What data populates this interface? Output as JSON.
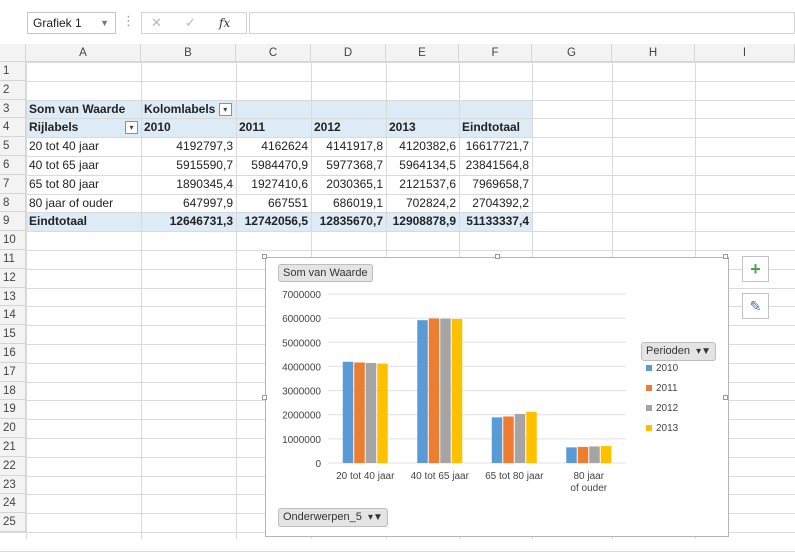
{
  "formula_bar": {
    "name_box": "Grafiek 1",
    "fx_label": "fx",
    "formula": ""
  },
  "columns": [
    "A",
    "B",
    "C",
    "D",
    "E",
    "F",
    "G",
    "H",
    "I"
  ],
  "rows": [
    "1",
    "2",
    "3",
    "4",
    "5",
    "6",
    "7",
    "8",
    "9",
    "10",
    "11",
    "12",
    "13",
    "14",
    "15",
    "16",
    "17",
    "18",
    "19",
    "20",
    "21",
    "22",
    "23",
    "24",
    "25"
  ],
  "pivot": {
    "values_header": "Som van Waarde",
    "column_labels": "Kolomlabels",
    "row_labels": "Rijlabels",
    "years": [
      "2010",
      "2011",
      "2012",
      "2013"
    ],
    "grand_total_label": "Eindtotaal",
    "data_rows": [
      {
        "label": "20 tot 40 jaar",
        "values": [
          "4192797,3",
          "4162624",
          "4141917,8",
          "4120382,6",
          "16617721,7"
        ]
      },
      {
        "label": "40 tot 65 jaar",
        "values": [
          "5915590,7",
          "5984470,9",
          "5977368,7",
          "5964134,5",
          "23841564,8"
        ]
      },
      {
        "label": "65 tot 80 jaar",
        "values": [
          "1890345,4",
          "1927410,6",
          "2030365,1",
          "2121537,6",
          "7969658,7"
        ]
      },
      {
        "label": "80 jaar of ouder",
        "values": [
          "647997,9",
          "667551",
          "686019,1",
          "702824,2",
          "2704392,2"
        ]
      }
    ],
    "total_row": {
      "label": "Eindtotaal",
      "values": [
        "12646731,3",
        "12742056,5",
        "12835670,7",
        "12908878,9",
        "51133337,4"
      ]
    }
  },
  "chart_field_buttons": {
    "values": "Som van Waarde",
    "legend": "Perioden",
    "axis": "Onderwerpen_5"
  },
  "chart_data": {
    "type": "bar",
    "categories": [
      "20 tot 40 jaar",
      "40 tot 65 jaar",
      "65 tot 80 jaar",
      "80 jaar of ouder"
    ],
    "series": [
      {
        "name": "2010",
        "color": "#5b9bd5",
        "values": [
          4192797.3,
          5915590.7,
          1890345.4,
          647997.9
        ]
      },
      {
        "name": "2011",
        "color": "#ed7d31",
        "values": [
          4162624,
          5984470.9,
          1927410.6,
          667551
        ]
      },
      {
        "name": "2012",
        "color": "#a5a5a5",
        "values": [
          4141917.8,
          5977368.7,
          2030365.1,
          686019.1
        ]
      },
      {
        "name": "2013",
        "color": "#ffc000",
        "values": [
          4120382.6,
          5964134.5,
          2121537.6,
          702824.2
        ]
      }
    ],
    "yticks": [
      "0",
      "1000000",
      "2000000",
      "3000000",
      "4000000",
      "5000000",
      "6000000",
      "7000000"
    ],
    "ylim": [
      0,
      7000000
    ],
    "legend_position": "right",
    "grid": true
  },
  "side_buttons": {
    "add_icon": "plus-icon",
    "style_icon": "brush-icon"
  }
}
